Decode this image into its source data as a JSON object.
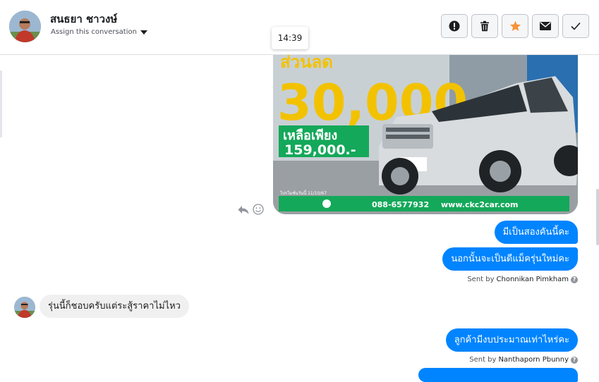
{
  "header": {
    "contact_name": "สนธยา ชาวงษ์",
    "assign_label": "Assign this conversation",
    "buttons": [
      {
        "name": "spam-button",
        "icon": "exclamation-icon"
      },
      {
        "name": "delete-button",
        "icon": "trash-icon"
      },
      {
        "name": "star-button",
        "icon": "star-icon",
        "color": "#f7923a"
      },
      {
        "name": "mark-unread-button",
        "icon": "envelope-icon"
      },
      {
        "name": "done-button",
        "icon": "checkmark-icon"
      }
    ]
  },
  "tooltip": {
    "time": "14:39"
  },
  "ad": {
    "headline_top": "ส่วนลด",
    "headline_amount": "30,000",
    "price_label": "เหลือเพียง",
    "price_value": "159,000.-",
    "footer_phone": "088-6577932",
    "footer_site": "www.ckc2car.com",
    "small_text": "โปรโมชั่นวันนี้ 11/10/67",
    "colors": {
      "yellow": "#f2c200",
      "green": "#14a85a"
    }
  },
  "messages": [
    {
      "id": "m1",
      "direction": "outgoing",
      "text": "มีเป็นสองคันนี้คะ"
    },
    {
      "id": "m2",
      "direction": "outgoing",
      "text": "นอกนั้นจะเป็นดีแม็ครุ่นใหม่คะ"
    },
    {
      "id": "m3",
      "direction": "incoming",
      "text": "รุ่นนี้ก็ชอบครับแต่ระสู้ราคาไม่ไหว"
    },
    {
      "id": "m4",
      "direction": "outgoing",
      "text": "ลูกค้ามีงบประมาณเท่าไหร่คะ"
    }
  ],
  "sent_by": [
    {
      "prefix": "Sent by",
      "name": "Chonnikan Pimkham"
    },
    {
      "prefix": "Sent by",
      "name": "Nanthaporn Pbunny"
    }
  ],
  "colors": {
    "outgoing_bubble": "#0084ff",
    "incoming_bubble": "#f1f0f0"
  }
}
